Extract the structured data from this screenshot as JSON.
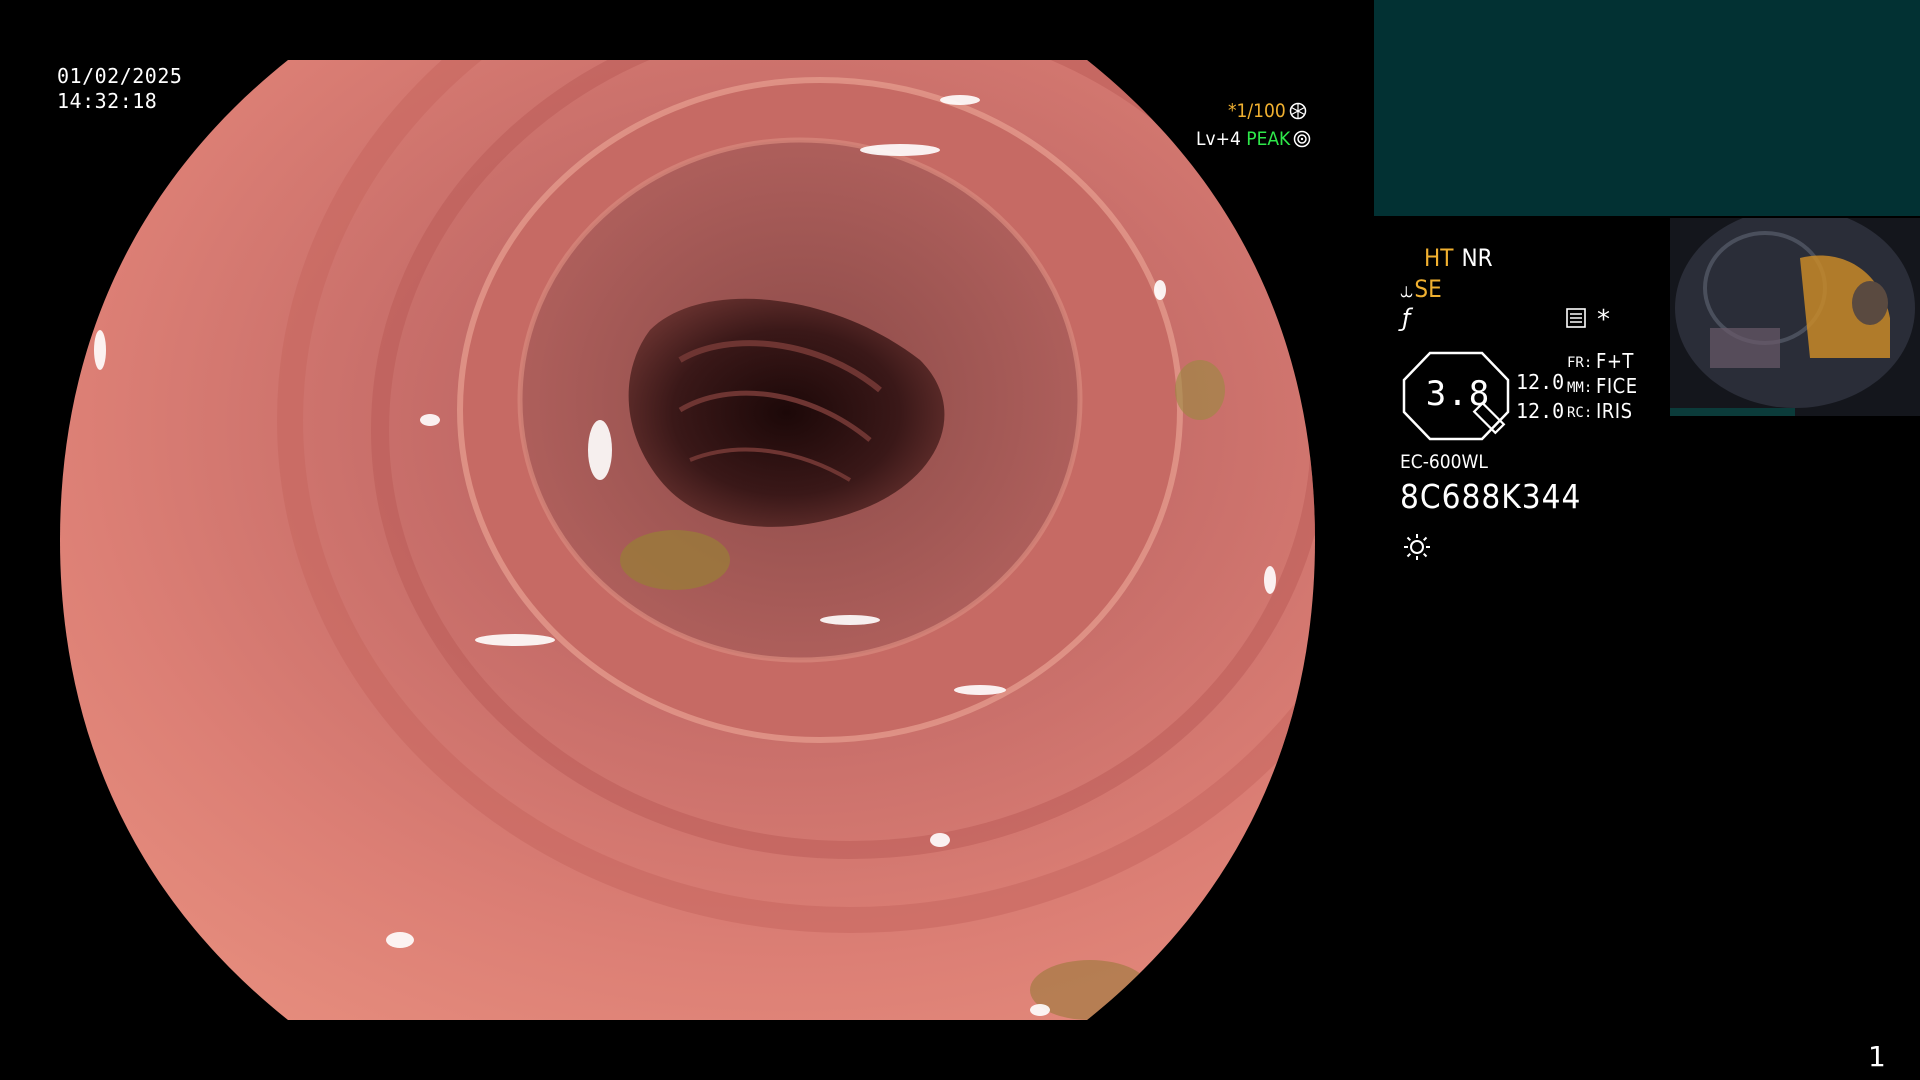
{
  "datetime": {
    "date": "01/02/2025",
    "time": "14:32:18"
  },
  "image_settings": {
    "shutter": "*1/100",
    "shutter_icon": "aperture-icon",
    "level": "Lv+4",
    "metering": "PEAK",
    "metering_icon": "target-icon"
  },
  "panel": {
    "ht_label": "HT",
    "nr_label": "NR",
    "se_label": "SE",
    "se_icon": "structure-enhance-icon",
    "f_icon": "function-icon",
    "asterisk": "*",
    "zoom_value": "3.8",
    "values": [
      "12.0",
      "12.0"
    ],
    "settings": [
      {
        "key": "FR:",
        "value": "F+T"
      },
      {
        "key": "MM:",
        "value": "FICE"
      },
      {
        "key": "RC:",
        "value": "IRIS"
      }
    ],
    "scope_model": "EC-600WL",
    "scope_serial": "8C688K344",
    "light_icon": "light-sun-icon"
  },
  "page_number": "1",
  "colors": {
    "panel_teal": "#023133",
    "label_amber": "#f0b030",
    "peak_green": "#2ee84a",
    "mucosa": "#d4776f",
    "lumen": "#3a1818"
  }
}
